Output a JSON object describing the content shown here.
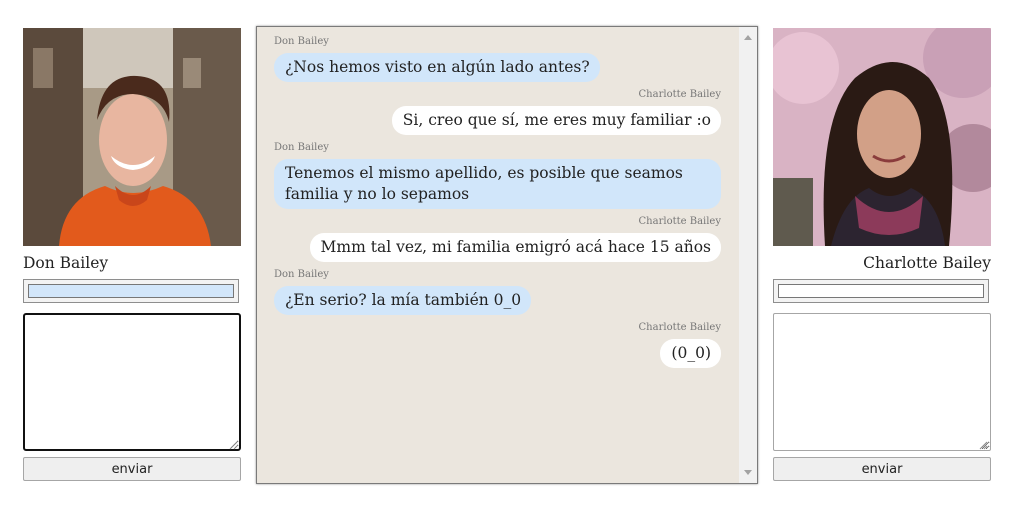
{
  "users": [
    {
      "name": "Don Bailey",
      "color_hex": "#d2e6fa",
      "message_value": "",
      "send_label": "enviar"
    },
    {
      "name": "Charlotte Bailey",
      "color_hex": "#ffffff",
      "message_value": "",
      "send_label": "enviar"
    }
  ],
  "chat": {
    "messages": [
      {
        "sender": "Don Bailey",
        "text": "¿Nos hemos visto en algún lado antes?"
      },
      {
        "sender": "Charlotte Bailey",
        "text": "Si, creo que sí, me eres muy familiar :o"
      },
      {
        "sender": "Don Bailey",
        "text": "Tenemos el mismo apellido, es posible que seamos familia y no lo sepamos"
      },
      {
        "sender": "Charlotte Bailey",
        "text": "Mmm tal vez, mi familia emigró acá hace 15 años"
      },
      {
        "sender": "Don Bailey",
        "text": "¿En serio? la mía también 0_0"
      },
      {
        "sender": "Charlotte Bailey",
        "text": "(0_0)"
      }
    ]
  },
  "colors": {
    "don_bubble": "#d1e6fa",
    "charlotte_bubble": "#ffffff",
    "chat_background": "#ebe6de"
  },
  "icons": {
    "photo_don": "avatar-photo",
    "photo_charlotte": "avatar-photo",
    "resize_grip": "resize-grip-icon",
    "scroll_up": "arrow-up-icon",
    "scroll_down": "arrow-down-icon"
  }
}
